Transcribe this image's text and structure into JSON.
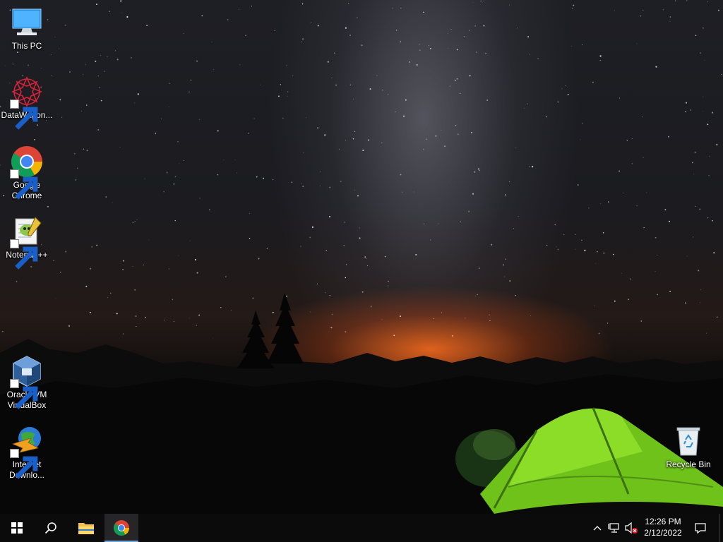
{
  "desktop": {
    "icons": [
      {
        "label": "This PC",
        "icon": "computer-icon"
      },
      {
        "label": "DataWagon...",
        "icon": "datawagon-icon"
      },
      {
        "label": "Google Chrome",
        "icon": "chrome-icon"
      },
      {
        "label": "Notepad++",
        "icon": "notepadpp-icon"
      },
      {
        "label": "Oracle VM VirtualBox",
        "icon": "virtualbox-icon"
      },
      {
        "label": "Internet Downlo...",
        "icon": "idm-icon"
      },
      {
        "label": "Recycle Bin",
        "icon": "recycle-bin-icon"
      }
    ]
  },
  "taskbar": {
    "start_icon": "windows-logo-icon",
    "search_icon": "search-icon",
    "pinned": [
      {
        "name": "File Explorer",
        "icon": "folder-icon",
        "active": false
      },
      {
        "name": "Google Chrome",
        "icon": "chrome-icon",
        "active": true
      }
    ],
    "tray": {
      "icons": [
        "chevron-up-icon",
        "network-icon",
        "volume-muted-icon"
      ],
      "time": "12:26 PM",
      "date": "2/12/2022",
      "notification_icon": "notification-icon"
    },
    "accent_color": "#6fa6d6"
  }
}
